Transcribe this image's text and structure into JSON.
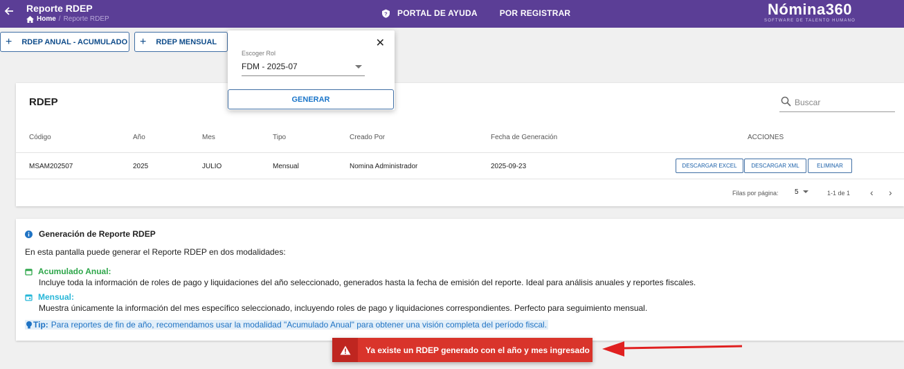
{
  "header": {
    "title": "Reporte RDEP",
    "breadcrumb_home": "Home",
    "breadcrumb_separator": "/",
    "breadcrumb_current": "Reporte RDEP",
    "help_link": "PORTAL DE AYUDA",
    "register_link": "POR REGISTRAR",
    "brand_name": "Nómina360",
    "brand_tagline": "SOFTWARE DE TALENTO HUMANO",
    "bar_color": "#5b3e96"
  },
  "toolbar": {
    "anual_button": "RDEP ANUAL - ACUMULADO",
    "mensual_button": "RDEP MENSUAL"
  },
  "popup": {
    "role_label": "Escoger Rol",
    "role_value": "FDM - 2025-07",
    "generate_button": "GENERAR"
  },
  "table": {
    "title": "RDEP",
    "search_placeholder": "Buscar",
    "columns": {
      "codigo": "Código",
      "anio": "Año",
      "mes": "Mes",
      "tipo": "Tipo",
      "creado_por": "Creado Por",
      "fecha": "Fecha de Generación",
      "acciones": "ACCIONES"
    },
    "rows": [
      {
        "codigo": "MSAM202507",
        "anio": "2025",
        "mes": "JULIO",
        "tipo": "Mensual",
        "creado_por": "Nomina Administrador",
        "fecha": "2025-09-23",
        "excel": "DESCARGAR EXCEL",
        "xml": "DESCARGAR XML",
        "eliminar": "ELIMINAR"
      }
    ],
    "pagination": {
      "rows_label": "Filas por página:",
      "rows_value": "5",
      "range": "1-1 de 1"
    }
  },
  "info": {
    "title": "Generación de Reporte RDEP",
    "intro": "En esta pantalla puede generar el Reporte RDEP en dos modalidades:",
    "anual_title": "Acumulado Anual:",
    "anual_desc": "Incluye toda la información de roles de pago y liquidaciones del año seleccionado, generados hasta la fecha de emisión del reporte. Ideal para análisis anuales y reportes fiscales.",
    "mensual_title": "Mensual:",
    "mensual_desc": "Muestra únicamente la información del mes específico seleccionado, incluyendo roles de pago y liquidaciones correspondientes. Perfecto para seguimiento mensual.",
    "tip_label": "Tip:",
    "tip_text": "Para reportes de fin de año, recomendamos usar la modalidad \"Acumulado Anual\" para obtener una visión completa del período fiscal.",
    "anual_color": "#2ea64a",
    "mensual_color": "#26b6d8"
  },
  "toast": {
    "message": "Ya existe un RDEP generado con el año y mes ingresado",
    "color": "#d9342b"
  }
}
